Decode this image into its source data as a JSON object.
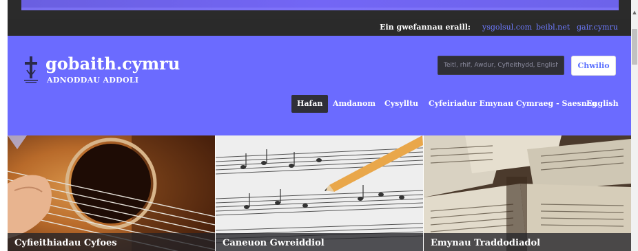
{
  "topbar": {
    "label": "Ein gwefannau eraill:",
    "links": [
      "ysgolsul.com",
      "beibl.net",
      "gair.cymru"
    ]
  },
  "header": {
    "title": "gobaith.cymru",
    "subtitle": "ADNODDAU ADDOLI",
    "logo_icon": "cross-icon"
  },
  "search": {
    "placeholder": "Teitl, rhif, Awdur, Cyfieithydd, English",
    "button_label": "Chwilio"
  },
  "nav": {
    "items": [
      "Hafan",
      "Amdanom",
      "Cysylltu",
      "Cyfeiriadur Emynau Cymraeg - Saesneg",
      "English"
    ],
    "active": "Hafan"
  },
  "tiles": [
    {
      "caption": "Cyfieithiadau Cyfoes",
      "image": "guitar-photo"
    },
    {
      "caption": "Caneuon Gwreiddiol",
      "image": "sheet-music-pencil-photo"
    },
    {
      "caption": "Emynau Traddodiadol",
      "image": "hymn-books-photo"
    }
  ],
  "colors": {
    "header_bg": "#6b6bff",
    "topbar_bg": "#2a2a2a",
    "link": "#6e7bff",
    "search_button_text": "#5d72ff"
  }
}
